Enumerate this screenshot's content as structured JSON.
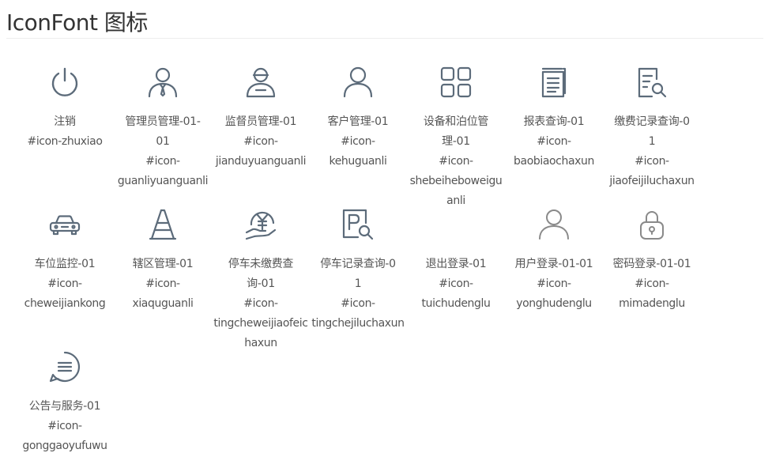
{
  "page": {
    "title": "IconFont 图标"
  },
  "icons": [
    {
      "name": "power-icon",
      "label": "注销",
      "code": "#icon-zhuxiao"
    },
    {
      "name": "admin-user-icon",
      "label": "管理员管理-01-01",
      "code": "#icon-\nguanliyuanguanli"
    },
    {
      "name": "supervisor-user-icon",
      "label": "监督员管理-01",
      "code": "#icon-\njianduyuanguanli"
    },
    {
      "name": "customer-user-icon",
      "label": "客户管理-01",
      "code": "#icon-\nkehuguanli"
    },
    {
      "name": "grid-apps-icon",
      "label": "设备和泊位管理-01",
      "code": "#icon-\nshebeiheboweiguanli"
    },
    {
      "name": "report-document-icon",
      "label": "报表查询-01",
      "code": "#icon-\nbaobiaochaxun"
    },
    {
      "name": "payment-record-search-icon",
      "label": "缴费记录查询-01",
      "code": "#icon-\njiaofeijiluchaxun"
    },
    {
      "name": "car-icon",
      "label": "车位监控-01",
      "code": "#icon-\ncheweijiankong"
    },
    {
      "name": "traffic-cone-icon",
      "label": "辖区管理-01",
      "code": "#icon-\nxiaquguanli"
    },
    {
      "name": "yen-hand-coin-icon",
      "label": "停车未缴费查询-01",
      "code": "#icon-\ntingcheweijiaofeichaxun"
    },
    {
      "name": "parking-search-icon",
      "label": "停车记录查询-01",
      "code": "#icon-\ntingchejiluchaxun"
    },
    {
      "name": "logout-blank-icon",
      "label": "退出登录-01",
      "code": "#icon-\ntuichudenglu"
    },
    {
      "name": "user-login-icon",
      "label": "用户登录-01-01",
      "code": "#icon-\nyonghudenglu"
    },
    {
      "name": "lock-icon",
      "label": "密码登录-01-01",
      "code": "#icon-\nmimadenglu"
    },
    {
      "name": "chat-bubble-icon",
      "label": "公告与服务-01",
      "code": "#icon-\ngonggaoyufuwu"
    }
  ],
  "colors": {
    "icon_stroke": "#5c6b7a",
    "icon_stroke_light": "#8a8a8a",
    "text": "#555555",
    "title": "#333333",
    "rule": "#eeeeee"
  }
}
